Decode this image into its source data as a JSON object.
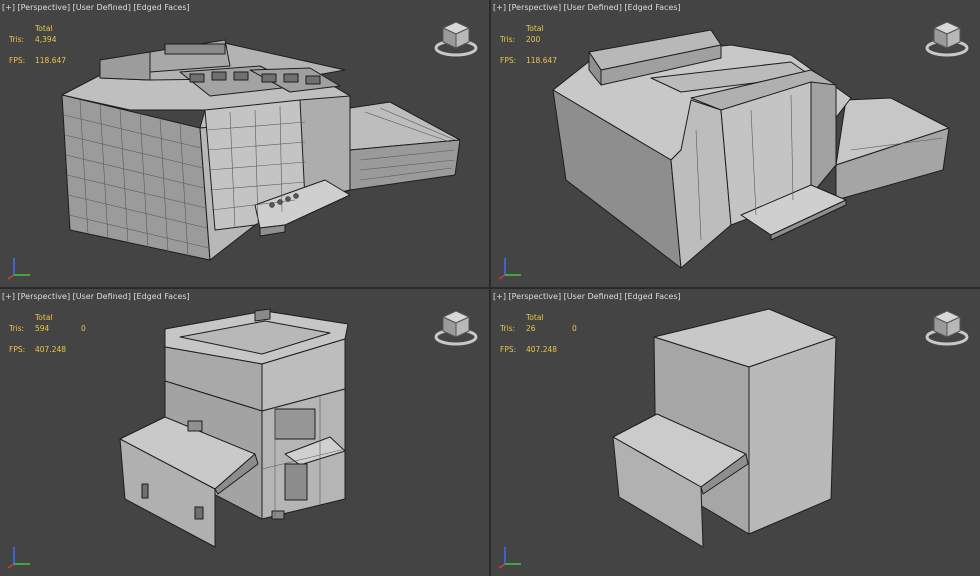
{
  "viewports": [
    {
      "menu": {
        "plus": "[+]",
        "view": "[Perspective]",
        "lighting": "[User Defined]",
        "shading": "[Edged Faces]"
      },
      "stats": {
        "total_label": "Total",
        "tris_label": "Tris:",
        "tris": "4,394",
        "tris_sel": "",
        "fps_label": "FPS:",
        "fps": "118.647"
      }
    },
    {
      "menu": {
        "plus": "[+]",
        "view": "[Perspective]",
        "lighting": "[User Defined]",
        "shading": "[Edged Faces]"
      },
      "stats": {
        "total_label": "Total",
        "tris_label": "Tris:",
        "tris": "200",
        "tris_sel": "",
        "fps_label": "FPS:",
        "fps": "118.647"
      }
    },
    {
      "menu": {
        "plus": "[+]",
        "view": "[Perspective]",
        "lighting": "[User Defined]",
        "shading": "[Edged Faces]"
      },
      "stats": {
        "total_label": "Total",
        "tris_label": "Tris:",
        "tris": "594",
        "tris_sel": "0",
        "fps_label": "FPS:",
        "fps": "407.248"
      }
    },
    {
      "menu": {
        "plus": "[+]",
        "view": "[Perspective]",
        "lighting": "[User Defined]",
        "shading": "[Edged Faces]"
      },
      "stats": {
        "total_label": "Total",
        "tris_label": "Tris:",
        "tris": "26",
        "tris_sel": "0",
        "fps_label": "FPS:",
        "fps": "407.248"
      }
    }
  ],
  "icons": {
    "viewcube": "viewcube-icon",
    "axis": "axis-tripod-icon"
  },
  "colors": {
    "viewport_bg": "#444444",
    "stats_text": "#e6c84a",
    "label_text": "#dcdcdc",
    "axis_x": "#d23c3c",
    "axis_y": "#3cc83c",
    "axis_z": "#3c6cff"
  }
}
